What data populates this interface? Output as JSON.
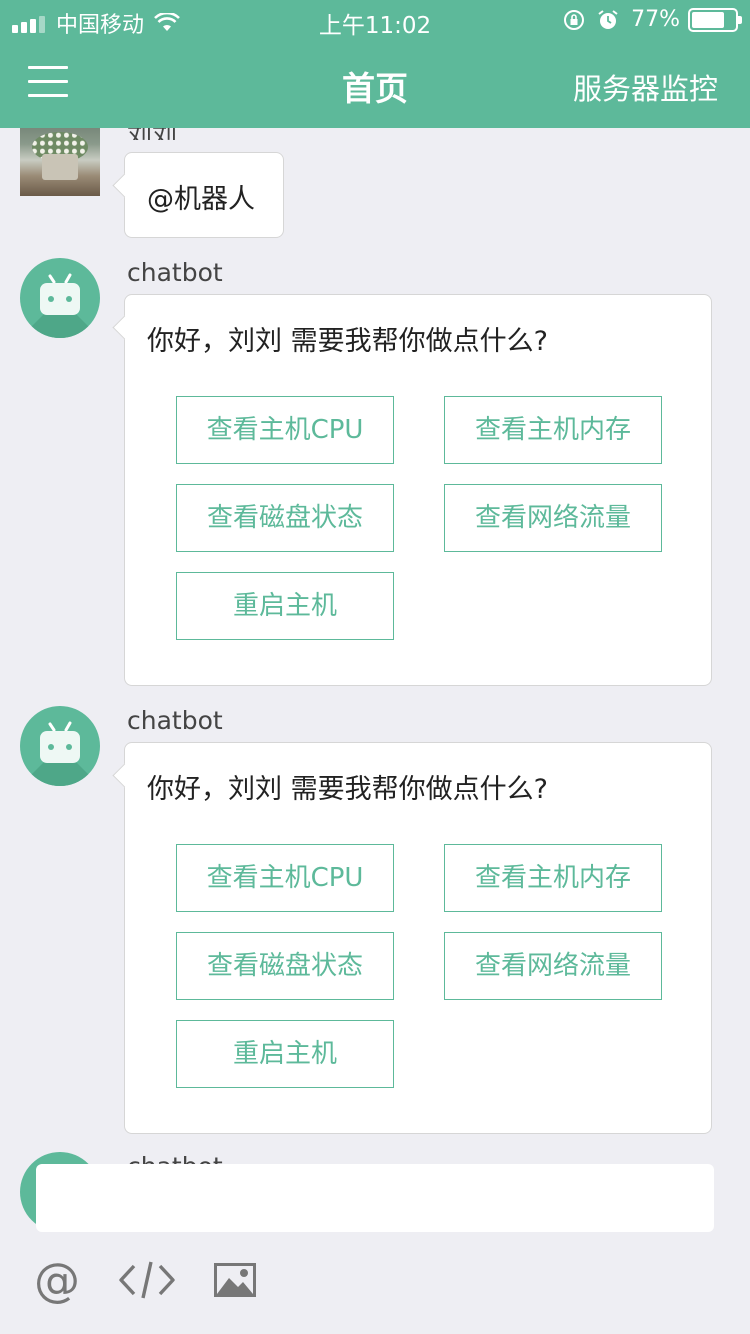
{
  "status_bar": {
    "carrier": "中国移动",
    "time": "上午11:02",
    "battery_percent": "77%",
    "battery_level": 0.77
  },
  "nav": {
    "title": "首页",
    "right_label": "服务器监控"
  },
  "messages": [
    {
      "sender": "刘刘",
      "text": "@机器人"
    },
    {
      "sender": "chatbot",
      "text": "你好，刘刘 需要我帮你做点什么?",
      "options": [
        "查看主机CPU",
        "查看主机内存",
        "查看磁盘状态",
        "查看网络流量",
        "重启主机"
      ]
    },
    {
      "sender": "chatbot",
      "text": "你好，刘刘 需要我帮你做点什么?",
      "options": [
        "查看主机CPU",
        "查看主机内存",
        "查看磁盘状态",
        "查看网络流量",
        "重启主机"
      ]
    }
  ],
  "peek_sender": "chatbot",
  "input": {
    "value": "",
    "placeholder": ""
  },
  "toolbar": {
    "at_symbol": "@",
    "icons": [
      "at-icon",
      "code-icon",
      "image-icon"
    ]
  },
  "colors": {
    "accent": "#5db99a",
    "background": "#eeeef3"
  }
}
